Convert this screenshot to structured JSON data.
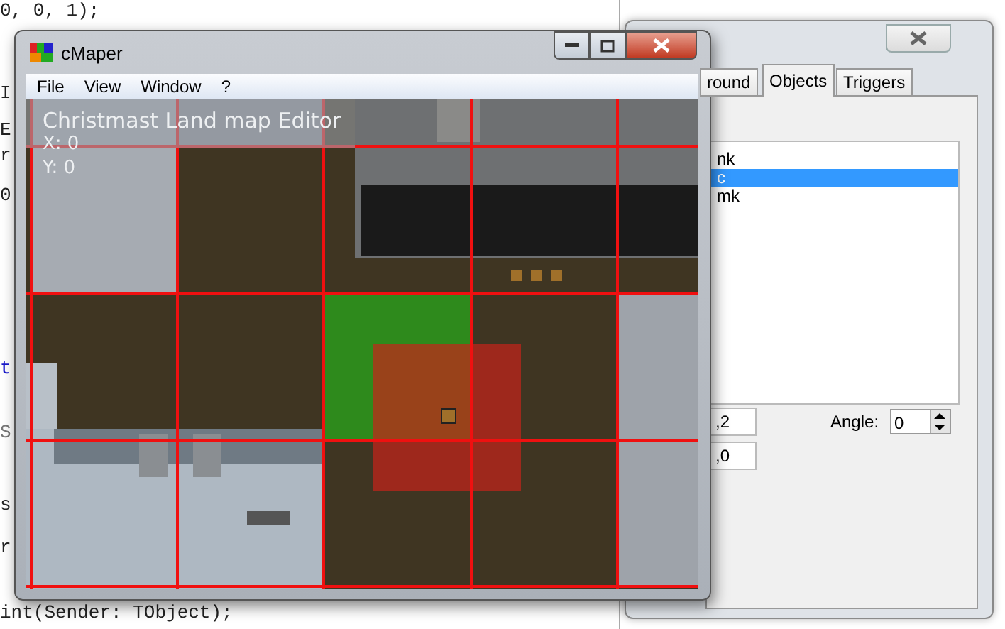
{
  "editor": {
    "lines": [
      {
        "text": "0, 0, 1);",
        "kind": "code"
      },
      {
        "text": "I",
        "kind": "code"
      },
      {
        "text": "E",
        "kind": "code"
      },
      {
        "text": "r",
        "kind": "code"
      },
      {
        "text": "0",
        "kind": "code"
      },
      {
        "text": "t",
        "kind": "keyword"
      },
      {
        "text": "S",
        "kind": "comment"
      },
      {
        "text": "s",
        "kind": "code"
      },
      {
        "text": "r",
        "kind": "code"
      },
      {
        "text": "int(Sender: TObject);",
        "kind": "code"
      }
    ]
  },
  "main_window": {
    "title": "cMaper",
    "menu": [
      "File",
      "View",
      "Window",
      "?"
    ],
    "overlay": {
      "title": "Christmast Land map Editor",
      "x": "X: 0",
      "y": "Y: 0"
    }
  },
  "side_window": {
    "tabs": [
      {
        "label": "round",
        "selected": false
      },
      {
        "label": "Objects",
        "selected": true
      },
      {
        "label": "Triggers",
        "selected": false
      }
    ],
    "objects": [
      {
        "label": "nk",
        "selected": false
      },
      {
        "label": "c",
        "selected": true
      },
      {
        "label": "mk",
        "selected": false
      }
    ],
    "fields": [
      ",2",
      ",0"
    ],
    "angle": {
      "label": "Angle:",
      "value": "0"
    }
  }
}
